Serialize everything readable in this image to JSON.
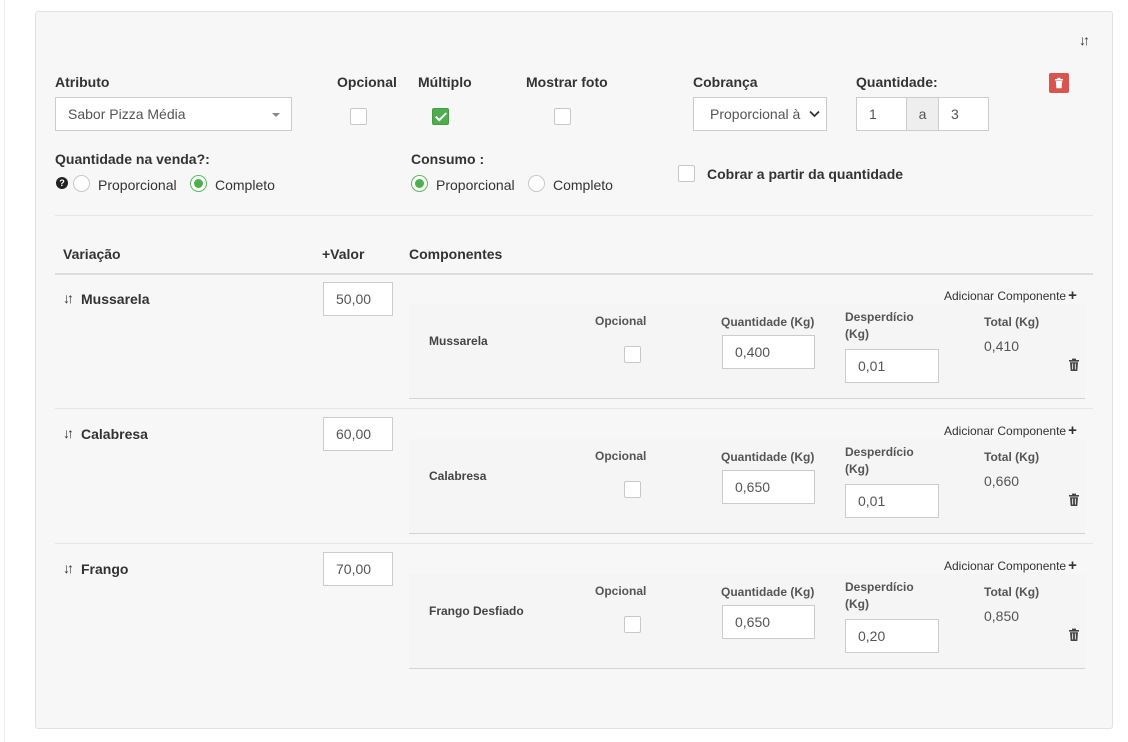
{
  "form": {
    "atributo_label": "Atributo",
    "atributo_value": "Sabor Pizza Média",
    "opcional_label": "Opcional",
    "multiplo_label": "Múltiplo",
    "mostrar_foto_label": "Mostrar foto",
    "cobranca_label": "Cobrança",
    "cobranca_value": "Proporcional à",
    "quantidade_label": "Quantidade:",
    "quantidade_min": "1",
    "quantidade_sep": "a",
    "quantidade_max": "3",
    "opcional_checked": false,
    "multiplo_checked": true,
    "mostrar_foto_checked": false,
    "qtd_venda_label": "Quantidade na venda?:",
    "qtd_venda_options": [
      "Proporcional",
      "Completo"
    ],
    "qtd_venda_selected": "Completo",
    "consumo_label": "Consumo :",
    "consumo_options": [
      "Proporcional",
      "Completo"
    ],
    "consumo_selected": "Proporcional",
    "cobrar_label": "Cobrar a partir da quantidade",
    "cobrar_checked": false
  },
  "icons": {
    "sort": "sort-arrows-icon",
    "trash": "trash-icon",
    "help": "question-circle-icon",
    "plus": "plus-icon",
    "caret": "caret-down-icon"
  },
  "colors": {
    "danger": "#d9534f",
    "success": "#4cae4c",
    "panel_bg": "#f7f7f7"
  },
  "table": {
    "col_variacao": "Variação",
    "col_valor": "+Valor",
    "col_componentes": "Componentes",
    "add_component_label": "Adicionar Componente",
    "comp_opcional_label": "Opcional",
    "comp_quantidade_label": "Quantidade (Kg)",
    "comp_desperdicio_label1": "Desperdício",
    "comp_desperdicio_label2": "(Kg)",
    "comp_total_label": "Total (Kg)",
    "rows": [
      {
        "name": "Mussarela",
        "valor": "50,00",
        "component": "Mussarela",
        "opcional": false,
        "quantidade": "0,400",
        "desperdicio": "0,01",
        "total": "0,410"
      },
      {
        "name": "Calabresa",
        "valor": "60,00",
        "component": "Calabresa",
        "opcional": false,
        "quantidade": "0,650",
        "desperdicio": "0,01",
        "total": "0,660"
      },
      {
        "name": "Frango",
        "valor": "70,00",
        "component": "Frango Desfiado",
        "opcional": false,
        "quantidade": "0,650",
        "desperdicio": "0,20",
        "total": "0,850"
      }
    ]
  }
}
